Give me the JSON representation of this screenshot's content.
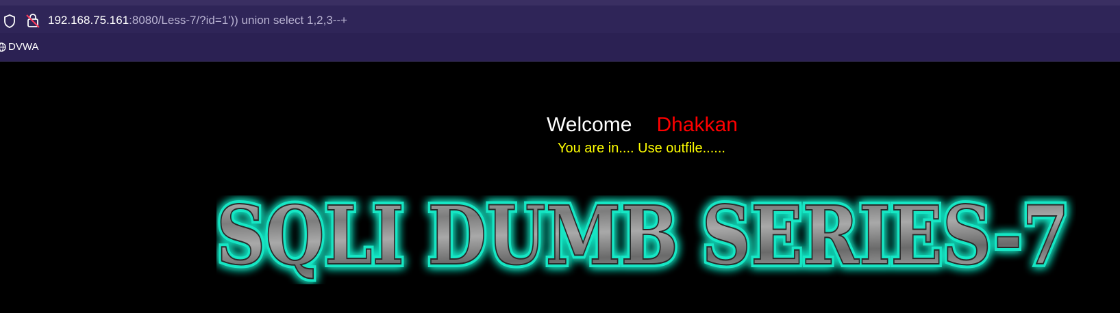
{
  "browser": {
    "url_host": "192.168.75.161",
    "url_rest": ":8080/Less-7/?id=1')) union select 1,2,3--+",
    "bookmarks": [
      {
        "label": "DVWA",
        "icon": "globe-icon"
      }
    ]
  },
  "page": {
    "welcome_word": "Welcome",
    "welcome_name": "Dhakkan",
    "status_message": "You are in.... Use outfile......",
    "banner_text": "SQLI DUMB SERIES-7"
  },
  "colors": {
    "page_background": "#000000",
    "welcome_text": "#ffffff",
    "name_text": "#ff0000",
    "status_text": "#ffff00",
    "banner_glow": "#19e6c4",
    "chrome_background": "#2b2153"
  }
}
